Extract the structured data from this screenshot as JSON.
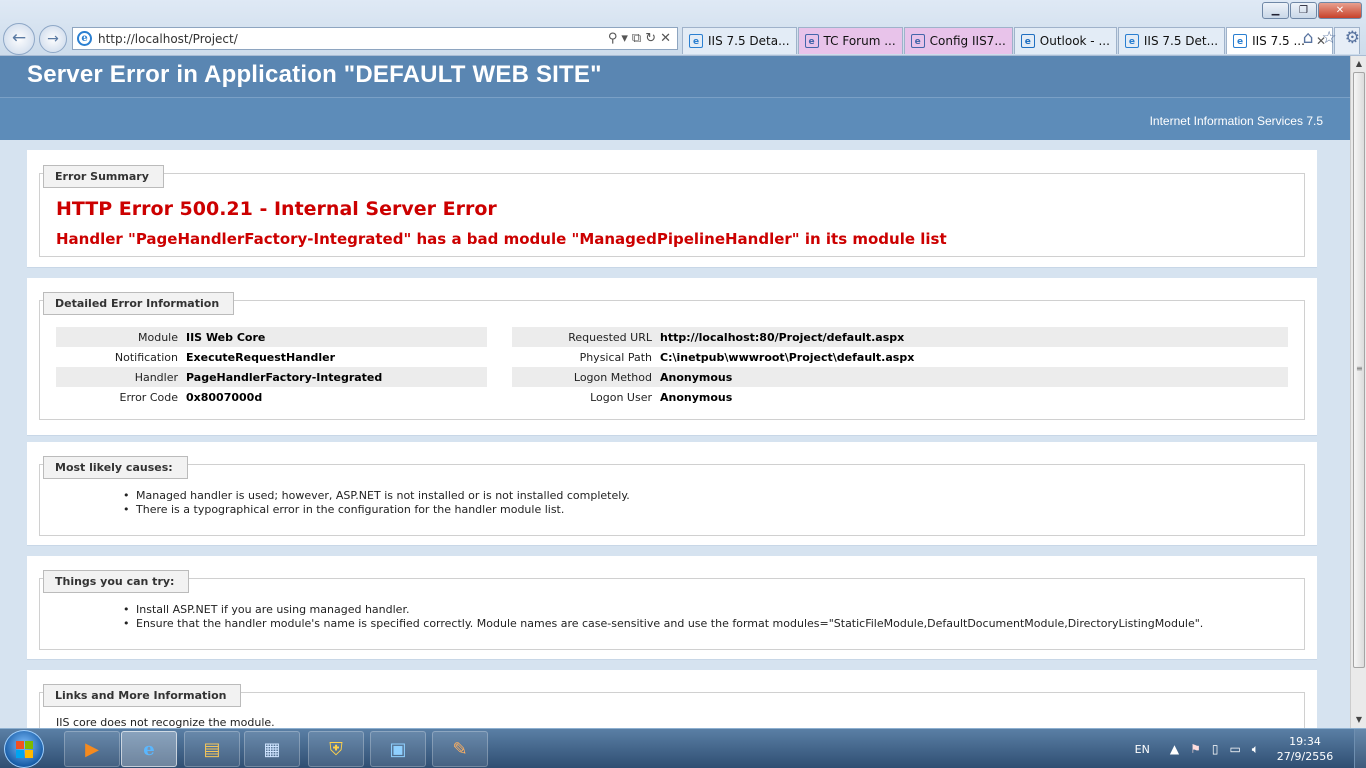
{
  "browser": {
    "url": "http://localhost/Project/",
    "tabs": [
      {
        "label": "IIS 7.5 Deta...",
        "icon_color": "#2a7fd1",
        "bg": "#e3ecf6"
      },
      {
        "label": "TC Forum ...",
        "icon_color": "#4466aa",
        "bg": "#e8c3ea"
      },
      {
        "label": "Config IIS7...",
        "icon_color": "#4466aa",
        "bg": "#e8c3ea"
      },
      {
        "label": "Outlook - ...",
        "icon_color": "#1f6fc1",
        "bg": "#e3ecf6"
      },
      {
        "label": "IIS 7.5 Det...",
        "icon_color": "#2a7fd1",
        "bg": "#e3ecf6"
      },
      {
        "label": "IIS 7.5 ...",
        "icon_color": "#2a7fd1",
        "bg": "#ffffff"
      }
    ],
    "window_buttons": {
      "minimize": "▁",
      "restore": "❐",
      "close": "✕"
    },
    "tab_close": "✕"
  },
  "page": {
    "title": "Server Error in Application \"DEFAULT WEB SITE\"",
    "iis_version": "Internet Information Services 7.5",
    "summary": {
      "legend": "Error Summary",
      "error_code": "HTTP Error 500.21 - Internal Server Error",
      "message": "Handler \"PageHandlerFactory-Integrated\" has a bad module \"ManagedPipelineHandler\" in its module list"
    },
    "detailed": {
      "legend": "Detailed Error Information",
      "left": [
        {
          "label": "Module",
          "value": "IIS Web Core"
        },
        {
          "label": "Notification",
          "value": "ExecuteRequestHandler"
        },
        {
          "label": "Handler",
          "value": "PageHandlerFactory-Integrated"
        },
        {
          "label": "Error Code",
          "value": "0x8007000d"
        }
      ],
      "right": [
        {
          "label": "Requested URL",
          "value": "http://localhost:80/Project/default.aspx"
        },
        {
          "label": "Physical Path",
          "value": "C:\\inetpub\\wwwroot\\Project\\default.aspx"
        },
        {
          "label": "Logon Method",
          "value": "Anonymous"
        },
        {
          "label": "Logon User",
          "value": "Anonymous"
        }
      ]
    },
    "causes": {
      "legend": "Most likely causes:",
      "items": [
        "Managed handler is used; however, ASP.NET is not installed or is not installed completely.",
        "There is a typographical error in the configuration for the handler module list."
      ]
    },
    "things": {
      "legend": "Things you can try:",
      "items": [
        "Install ASP.NET if you are using managed handler.",
        "Ensure that the handler module's name is specified correctly. Module names are case-sensitive and use the format modules=\"StaticFileModule,DefaultDocumentModule,DirectoryListingModule\"."
      ]
    },
    "links": {
      "legend": "Links and More Information",
      "text": "IIS core does not recognize the module."
    }
  },
  "taskbar": {
    "language": "EN",
    "time": "19:34",
    "date": "27/9/2556"
  }
}
